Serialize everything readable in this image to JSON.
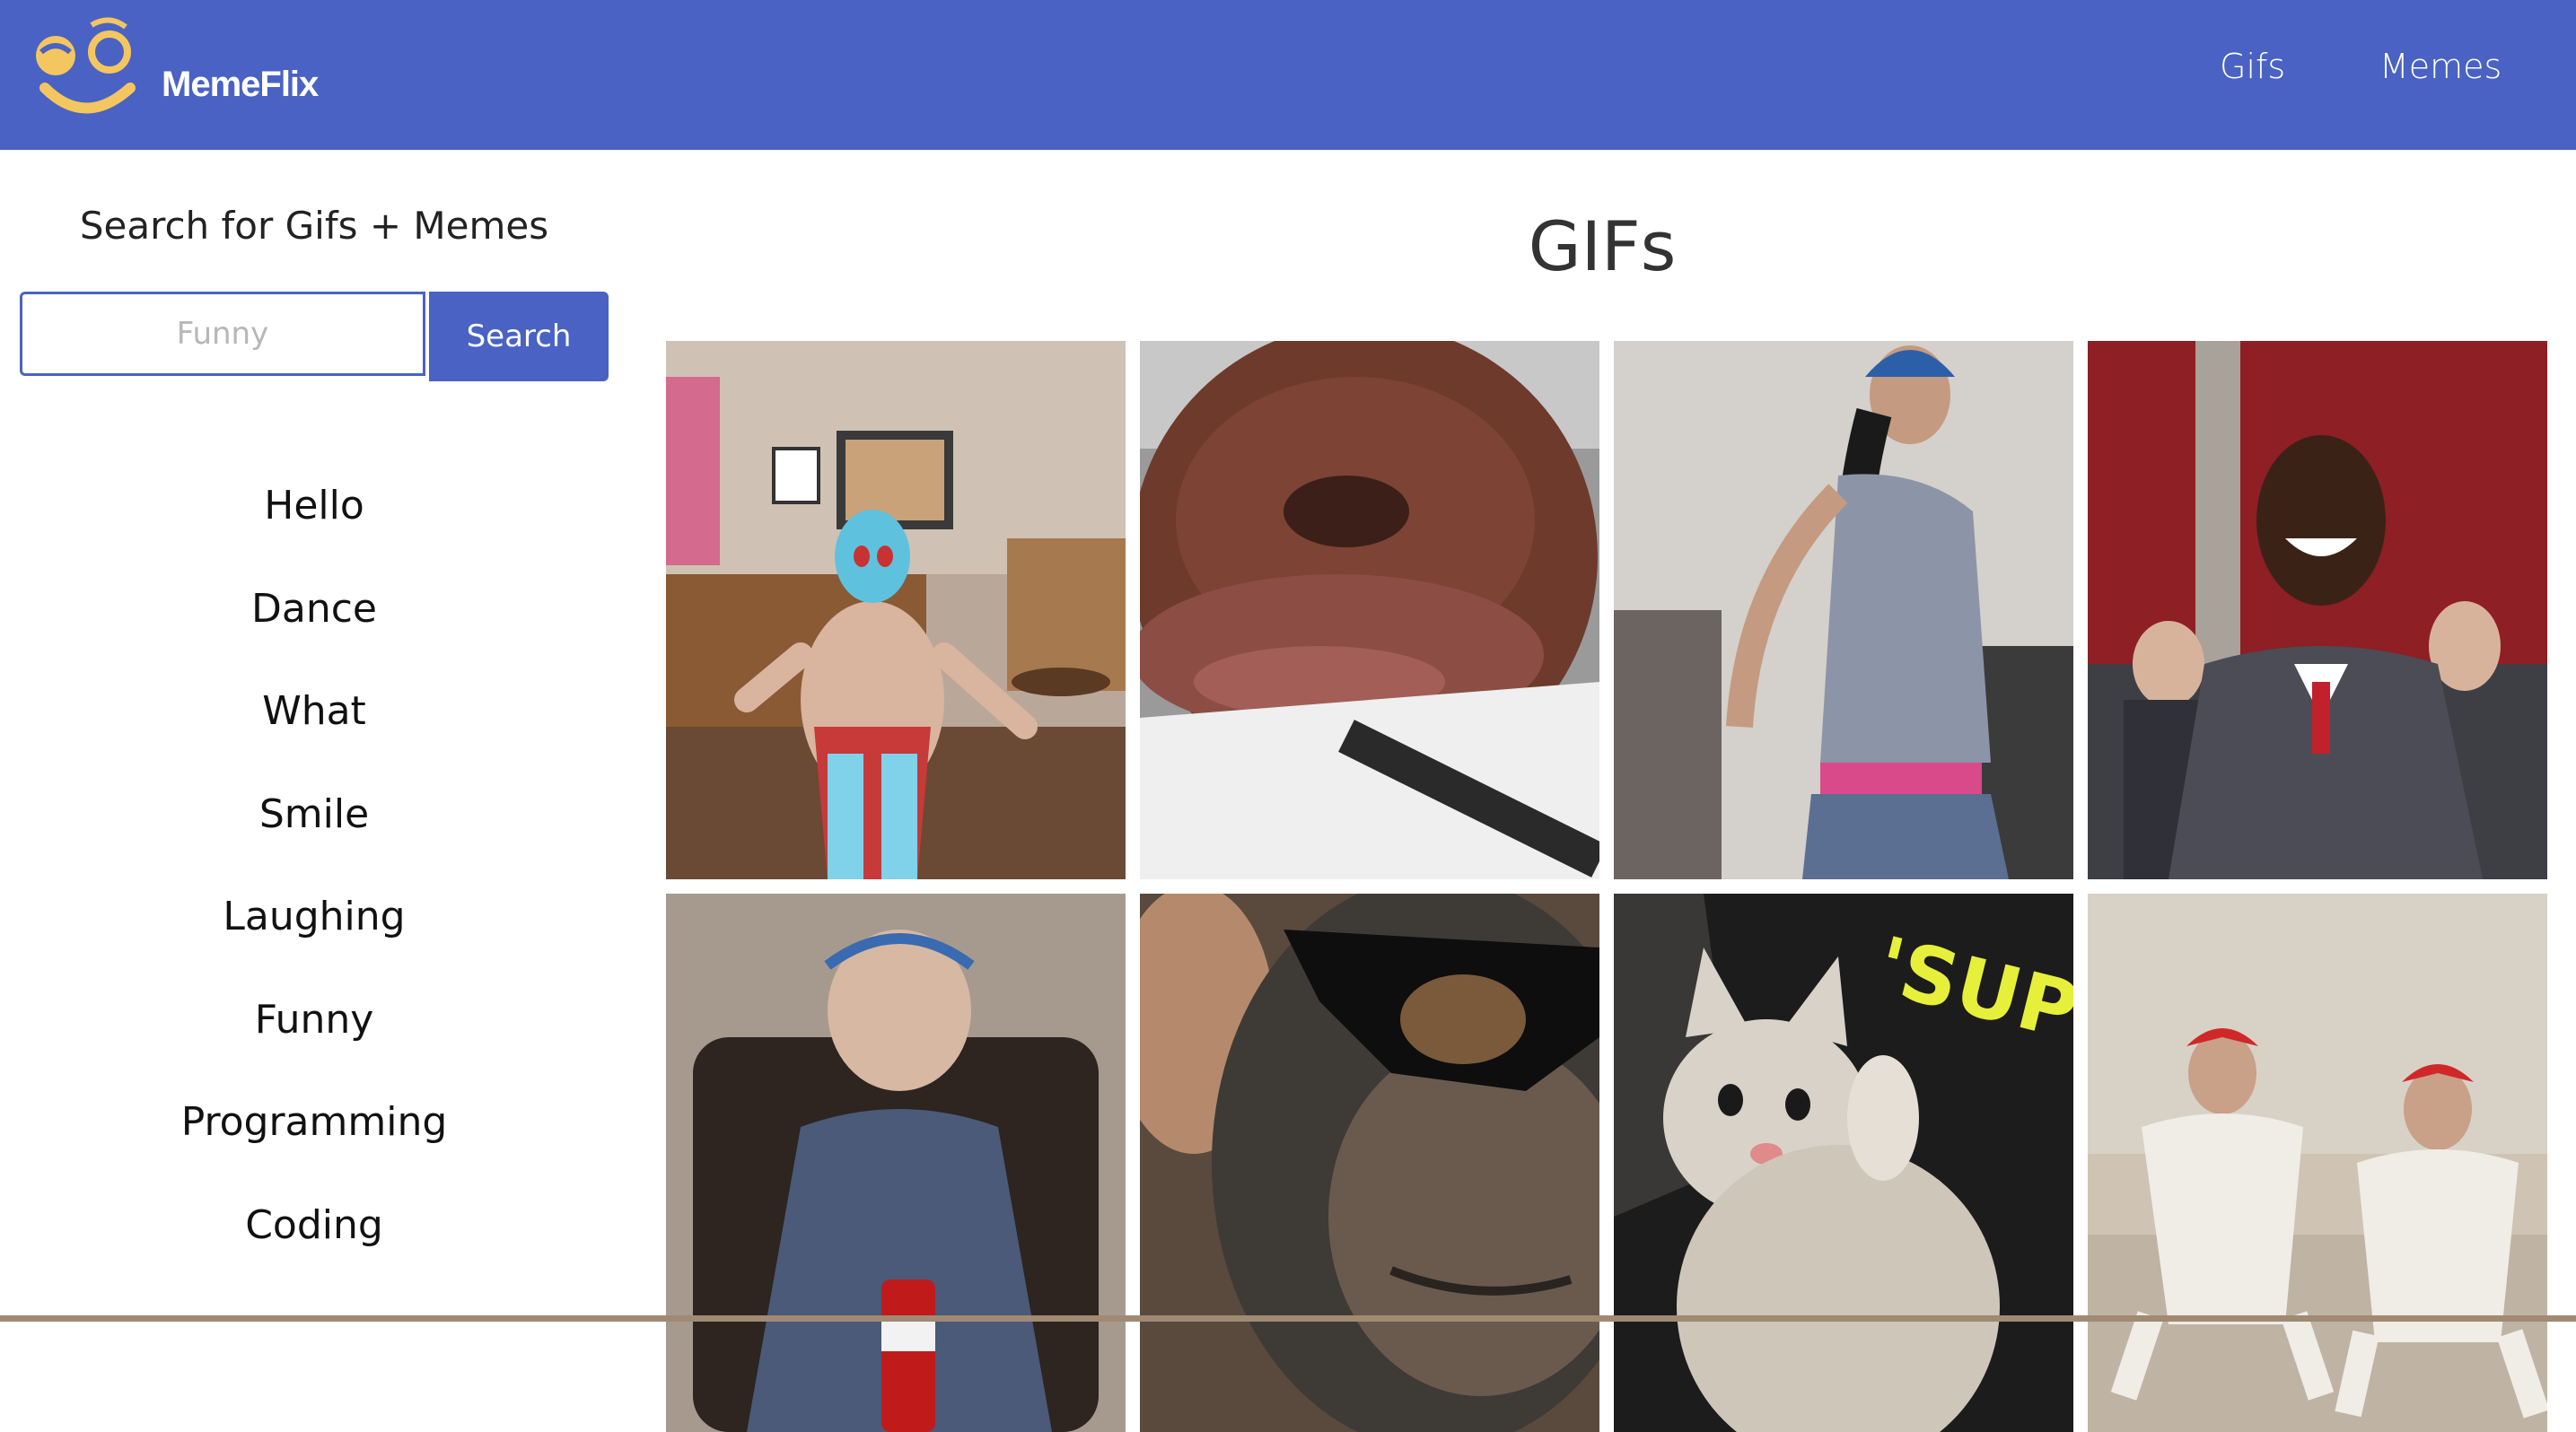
{
  "navbar": {
    "brand": "MemeFlix",
    "links": [
      "Gifs",
      "Memes"
    ],
    "background_color": "#4a62c4",
    "logo_icon": "smiley-face-icon"
  },
  "sidebar": {
    "title": "Search for Gifs + Memes",
    "search": {
      "placeholder": "Funny",
      "value": "",
      "button_label": "Search"
    },
    "topics": [
      "Hello",
      "Dance",
      "What",
      "Smile",
      "Laughing",
      "Funny",
      "Programming",
      "Coding"
    ]
  },
  "main": {
    "title": "GIFs",
    "gifs": [
      {
        "name": "luchador-dancing-gif"
      },
      {
        "name": "dog-face-window-gif"
      },
      {
        "name": "woman-dancing-gif"
      },
      {
        "name": "man-laughing-suit-gif"
      },
      {
        "name": "woman-drinking-soda-gif"
      },
      {
        "name": "chimp-sunglasses-gif"
      },
      {
        "name": "kitten-sup-gif",
        "caption": "'SUP?"
      },
      {
        "name": "chicken-suit-dance-gif"
      }
    ]
  }
}
